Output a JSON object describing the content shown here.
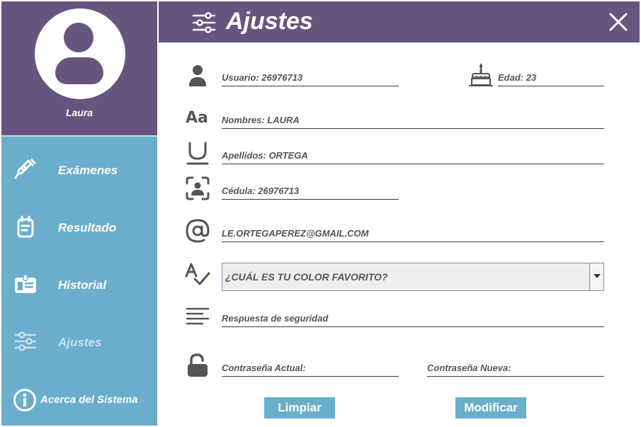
{
  "profile": {
    "name": "Laura"
  },
  "nav": {
    "items": [
      {
        "label": "Exámenes",
        "icon": "syringe-icon"
      },
      {
        "label": "Resultado",
        "icon": "clipboard-icon"
      },
      {
        "label": "Historial",
        "icon": "id-card-icon"
      },
      {
        "label": "Ajustes",
        "icon": "sliders-icon",
        "active": true
      }
    ],
    "about": "Acerca del Sistema"
  },
  "header": {
    "title": "Ajustes"
  },
  "form": {
    "usuario": "Usuario: 26976713",
    "edad": "Edad: 23",
    "nombres": "Nombres: LAURA",
    "apellidos": "Apellidos: ORTEGA",
    "cedula": "Cédula: 26976713",
    "email": "LE.ORTEGAPEREZ@GMAIL.COM",
    "pregunta": "¿CUÁL ES TU COLOR FAVORITO?",
    "respuesta": "Respuesta de seguridad",
    "contrasena_actual": "Contraseña Actual:",
    "contrasena_nueva": "Contraseña Nueva:"
  },
  "buttons": {
    "limpiar": "Limpiar",
    "modificar": "Modificar"
  },
  "colors": {
    "purple": "#66567f",
    "blue": "#6aaecc",
    "icon": "#555555"
  }
}
